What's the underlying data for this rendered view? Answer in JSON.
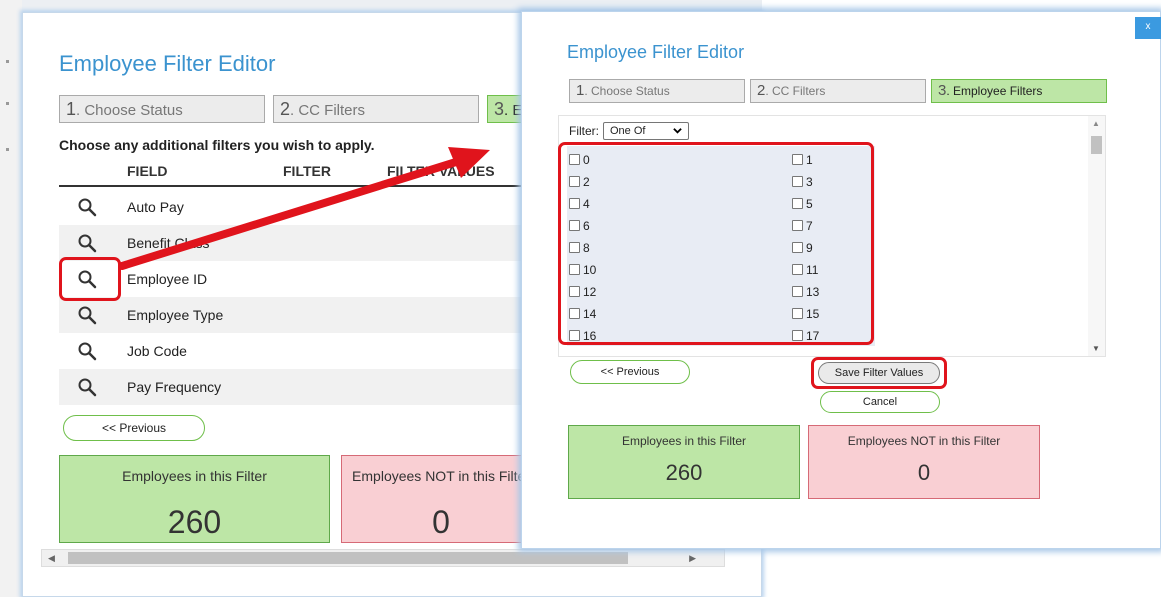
{
  "colors": {
    "accent": "#3b93cf",
    "green_box": "#bde6a6",
    "red_box": "#f9cfd3",
    "annotation_red": "#e0141c"
  },
  "back_dialog": {
    "title": "Employee Filter Editor",
    "steps": [
      {
        "num": "1",
        "label": ". Choose Status"
      },
      {
        "num": "2",
        "label": ". CC Filters"
      },
      {
        "num": "3",
        "label": ". Employee Filters"
      }
    ],
    "instruction": "Choose any additional filters you wish to apply.",
    "columns": {
      "field": "FIELD",
      "filter": "FILTER",
      "filter_values": "FILTER VALUES"
    },
    "rows": [
      {
        "label": "Auto Pay",
        "icon": "magnifier-icon"
      },
      {
        "label": "Benefit Class",
        "icon": "magnifier-icon"
      },
      {
        "label": "Employee ID",
        "icon": "magnifier-icon"
      },
      {
        "label": "Employee Type",
        "icon": "magnifier-icon"
      },
      {
        "label": "Job Code",
        "icon": "magnifier-icon"
      },
      {
        "label": "Pay Frequency",
        "icon": "magnifier-icon"
      }
    ],
    "previous_label": "<< Previous",
    "in_filter": {
      "caption": "Employees in this Filter",
      "count": "260"
    },
    "not_in_filter": {
      "caption": "Employees NOT in this Filter",
      "count": "0"
    }
  },
  "front_dialog": {
    "title": "Employee Filter Editor",
    "close_label": "x",
    "steps": [
      {
        "num": "1",
        "label": ". Choose Status"
      },
      {
        "num": "2",
        "label": ". CC Filters"
      },
      {
        "num": "3",
        "label": ". Employee Filters"
      }
    ],
    "filter_label": "Filter:",
    "filter_select_value": "One Of",
    "checkboxes": [
      "0",
      "1",
      "2",
      "3",
      "4",
      "5",
      "6",
      "7",
      "8",
      "9",
      "10",
      "11",
      "12",
      "13",
      "14",
      "15",
      "16",
      "17"
    ],
    "previous_label": "<< Previous",
    "save_label": "Save Filter Values",
    "cancel_label": "Cancel",
    "in_filter": {
      "caption": "Employees in this Filter",
      "count": "260"
    },
    "not_in_filter": {
      "caption": "Employees NOT in this Filter",
      "count": "0"
    }
  }
}
